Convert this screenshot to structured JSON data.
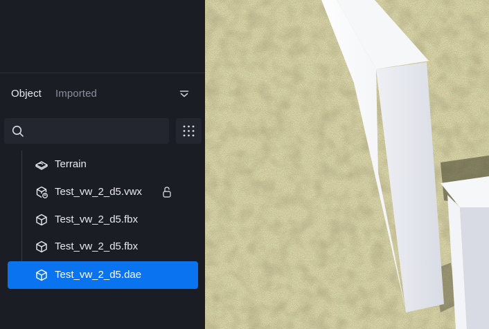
{
  "panel": {
    "tabs": [
      {
        "label": "Object",
        "active": true
      },
      {
        "label": "Imported",
        "active": false
      }
    ],
    "search": {
      "placeholder": "",
      "value": ""
    },
    "items": [
      {
        "label": "Terrain",
        "icon": "terrain-icon",
        "selected": false,
        "locked": false
      },
      {
        "label": "Test_vw_2_d5.vwx",
        "icon": "model-linked-icon",
        "selected": false,
        "locked": true
      },
      {
        "label": "Test_vw_2_d5.fbx",
        "icon": "cube-icon",
        "selected": false,
        "locked": false
      },
      {
        "label": "Test_vw_2_d5.fbx",
        "icon": "cube-icon",
        "selected": false,
        "locked": false
      },
      {
        "label": "Test_vw_2_d5.dae",
        "icon": "cube-icon",
        "selected": true,
        "locked": false
      }
    ]
  },
  "colors": {
    "panel_bg": "#1a1d24",
    "input_bg": "#23262e",
    "accent": "#0a74f0",
    "text_primary": "#e8eaee",
    "text_muted": "#8a8f99"
  }
}
